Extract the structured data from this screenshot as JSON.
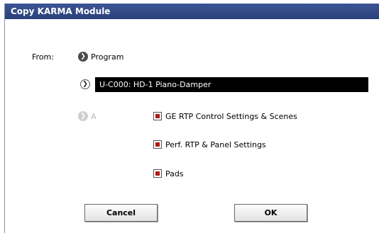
{
  "dialog": {
    "title": "Copy KARMA Module",
    "from_label": "From:",
    "source": "Program",
    "program": "U-C000: HD-1 Piano-Damper",
    "module": "A",
    "options": [
      {
        "label": "GE RTP Control Settings & Scenes",
        "checked": true
      },
      {
        "label": "Perf. RTP & Panel Settings",
        "checked": true
      },
      {
        "label": "Pads",
        "checked": true
      }
    ],
    "cancel_label": "Cancel",
    "ok_label": "OK"
  },
  "icons": {
    "source_arrow": "chevron-right-icon",
    "program_arrow": "chevron-right-icon",
    "module_arrow": "chevron-right-icon"
  },
  "colors": {
    "titlebar": "#2f4684",
    "check_mark": "#b01818",
    "program_field_bg": "#000000"
  }
}
